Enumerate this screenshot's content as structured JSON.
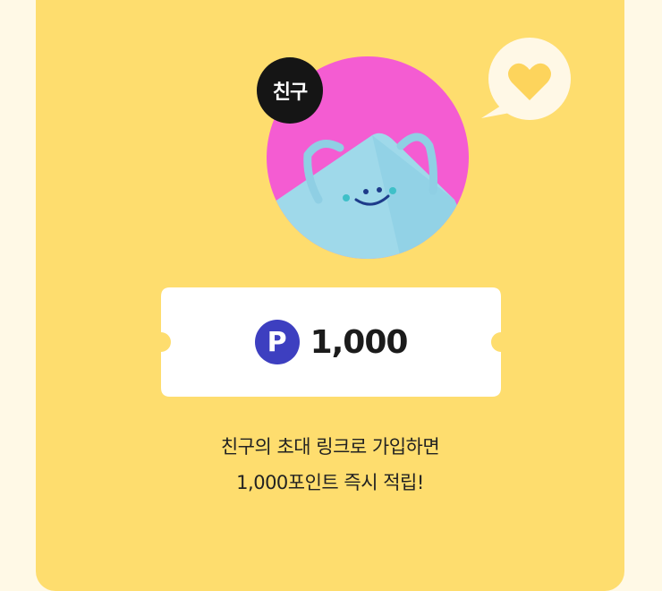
{
  "badge": {
    "label": "친구"
  },
  "icons": {
    "heart": "heart-icon",
    "point": "point-icon",
    "character": "mask-character-icon"
  },
  "ticket": {
    "point_symbol": "P",
    "amount": "1,000"
  },
  "description": {
    "line1": "친구의 초대 링크로 가입하면",
    "line2": "1,000포인트 즉시 적립!"
  },
  "colors": {
    "card_bg": "#fedd6e",
    "page_bg": "#fff9e6",
    "circle": "#f45cd2",
    "badge": "#151515",
    "point_icon": "#3d3fc0"
  }
}
